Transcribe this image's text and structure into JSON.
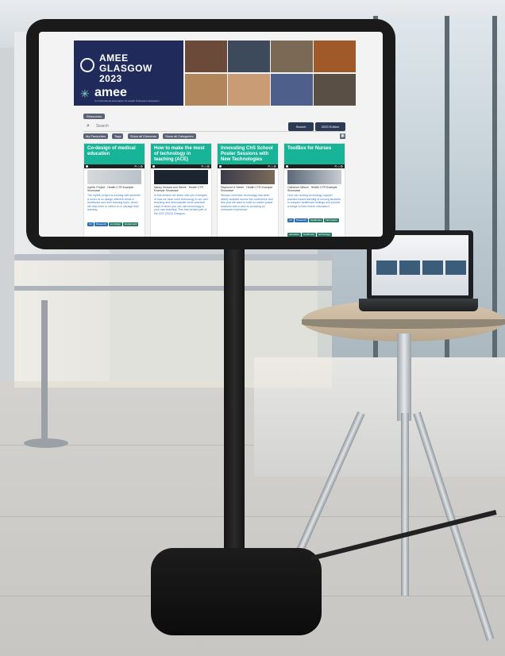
{
  "screen": {
    "banner": {
      "brand_line1": "AMEE",
      "brand_line2": "GLASGOW",
      "brand_line3": "2023",
      "brand_name": "amee",
      "brand_tagline": "An International Association for Health Professions Education",
      "accent_color": "#202b5b"
    },
    "toolbar": {
      "top_tab": "Resources",
      "search_placeholder": "Search",
      "search_button": "Search",
      "edition_button": "2023 Edition",
      "filters": [
        "My Favourites",
        "Tags",
        "Show all Elements",
        "Show all Categories"
      ]
    },
    "cards": [
      {
        "title": "Co-design of medical education",
        "author": "myMIL Project · Health CTR Example Showcase",
        "body": "The myMIL project is working with students & tutors to co-design different views in healthcare and their learning tools, which will help them to reflect on & manage their learning.",
        "tags": [
          "UX",
          "Research",
          "co-design",
          "student-led",
          "collaboration",
          "education",
          "technology"
        ]
      },
      {
        "title": "How to make the most of technology in teaching (ACE)",
        "author": "Nancy Howard and Steele · Health CTR Example Showcase",
        "body": "In this session we share with you examples of how we have used technology in our own teaching and demonstrate some practical ways in which you can use technology in your own teaching. This has formed part of the ACE (2023) Glasgow...",
        "tags": []
      },
      {
        "title": "Innovating ChS School Poster Sessions with New Technologies",
        "author": "Raymond & Steele · Health CTR Example Showcase",
        "body": "Session overview: technology has been widely adopted across the conference and this year we want to build on earlier poster sessions with a view to providing an enhanced experience.",
        "tags": []
      },
      {
        "title": "ToolBox for Nurses",
        "author": "Catherine Wilson · Health CTR Example Showcase",
        "body": "How can nursing technology support practice-based learning of nursing students in complex healthcare settings and provide a bridge to their further education?",
        "tags": [
          "UX",
          "Research",
          "healthcare",
          "Informatics",
          "education",
          "healthcare",
          "technology"
        ]
      }
    ]
  },
  "scene": {
    "monitor_color": "#1a1a1a",
    "card_header_color": "#17b497"
  }
}
